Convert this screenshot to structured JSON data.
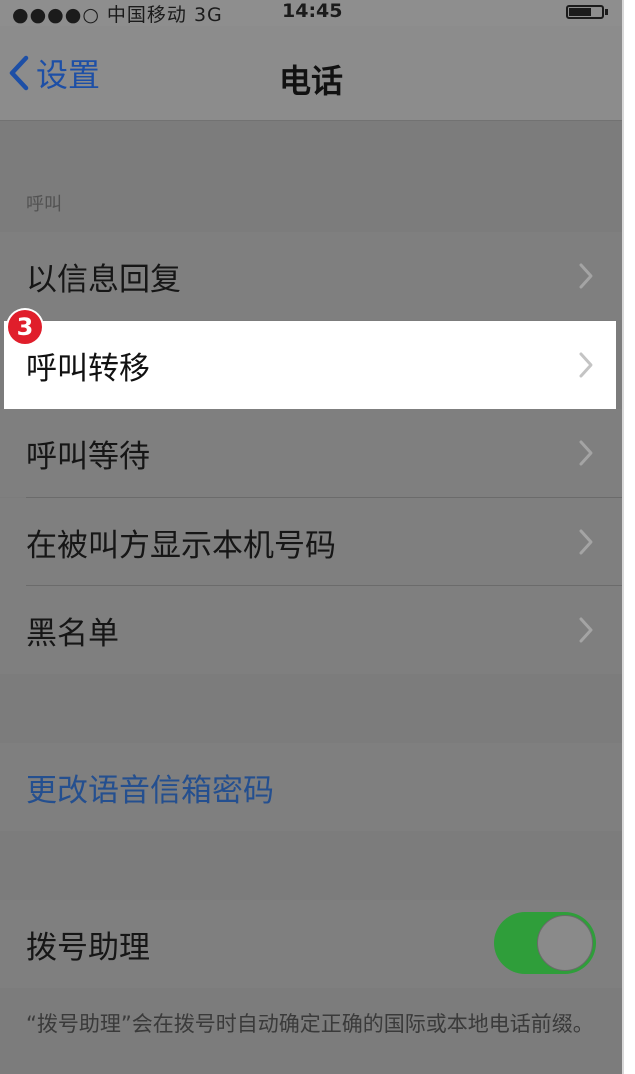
{
  "status_bar": {
    "carrier": "●●●●○ 中国移动  3G",
    "time": "14:45"
  },
  "nav": {
    "back_label": "设置",
    "title": "电话"
  },
  "calls_section": {
    "header": "呼叫",
    "rows": [
      {
        "label": "以信息回复"
      },
      {
        "label": "呼叫转移"
      },
      {
        "label": "呼叫等待"
      },
      {
        "label": "在被叫方显示本机号码"
      },
      {
        "label": "黑名单"
      }
    ]
  },
  "step_badge": "3",
  "voicemail": {
    "label": "更改语音信箱密码"
  },
  "dial_assist": {
    "label": "拨号助理",
    "enabled": true,
    "footnote": "“拨号助理”会在拨号时自动确定正确的国际或本地电话前缀。"
  },
  "colors": {
    "accent": "#1d4fa6",
    "toggle_on": "#2f9e3a",
    "badge": "#e01e2b",
    "highlight": "#ffffff"
  },
  "icons": {
    "back": "chevron-left-icon",
    "disclosure": "chevron-right-icon",
    "battery": "battery-icon"
  }
}
